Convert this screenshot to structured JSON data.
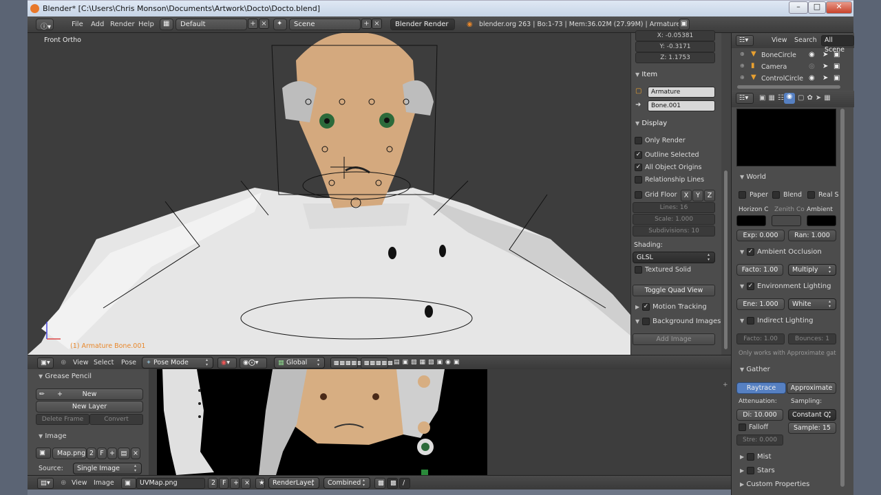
{
  "window": {
    "title": "Blender* [C:\\Users\\Chris Monson\\Documents\\Artwork\\Docto\\Docto.blend]"
  },
  "info_header": {
    "menus": [
      "File",
      "Add",
      "Render",
      "Help"
    ],
    "layout": "Default",
    "scene": "Scene",
    "engine": "Blender Render",
    "stats": "blender.org 263 | Bo:1-73 | Mem:36.02M (27.99M) | Armature"
  },
  "viewport": {
    "view_label": "Front Ortho",
    "object_label": "(1) Armature Bone.001"
  },
  "npanel": {
    "coords": {
      "x": "X: -0.05381",
      "y": "Y: -0.3171",
      "z": "Z: 1.1753"
    },
    "item_header": "Item",
    "object_name": "Armature",
    "bone_name": "Bone.001",
    "display_header": "Display",
    "only_render": "Only Render",
    "outline_selected": "Outline Selected",
    "all_object_origins": "All Object Origins",
    "relationship_lines": "Relationship Lines",
    "grid_floor": "Grid Floor",
    "axis_x": "X",
    "axis_y": "Y",
    "axis_z": "Z",
    "lines": "Lines: 16",
    "scale": "Scale: 1.000",
    "subdivisions": "Subdivisions: 10",
    "shading_label": "Shading:",
    "shading_value": "GLSL",
    "textured_solid": "Textured Solid",
    "toggle_quad": "Toggle Quad View",
    "motion_tracking": "Motion Tracking",
    "background_images": "Background Images",
    "add_image": "Add Image"
  },
  "outliner": {
    "menus": [
      "View",
      "Search",
      "All Scene"
    ],
    "items": [
      "BoneCircle",
      "Camera",
      "ControlCircle"
    ]
  },
  "properties": {
    "world_header": "World",
    "paper": "Paper",
    "blend": "Blend",
    "real": "Real S",
    "horizon": "Horizon C",
    "zenith": "Zenith Co",
    "ambient": "Ambient",
    "exposure": "Exp: 0.000",
    "range": "Ran: 1.000",
    "ao_header": "Ambient Occlusion",
    "ao_factor": "Facto: 1.00",
    "ao_mode": "Multiply",
    "env_header": "Environment Lighting",
    "env_energy": "Ene: 1.000",
    "env_color": "White",
    "indirect_header": "Indirect Lighting",
    "ind_factor": "Facto: 1.00",
    "ind_bounces": "Bounces: 1",
    "ind_note": "Only works with Approximate gat",
    "gather_header": "Gather",
    "raytrace": "Raytrace",
    "approximate": "Approximate",
    "attenuation": "Attenuation:",
    "sampling": "Sampling:",
    "distance": "Di: 10.000",
    "sampling_value": "Constant Q",
    "falloff": "Falloff",
    "samples": "Sample: 15",
    "strength": "Stre: 0.000",
    "mist": "Mist",
    "stars": "Stars",
    "custom": "Custom Properties",
    "colors": {
      "horizon": "#000000",
      "zenith": "#4a4a4a",
      "ambient": "#000000"
    }
  },
  "v3d_header": {
    "menus": [
      "View",
      "Select",
      "Pose"
    ],
    "mode": "Pose Mode",
    "orientation": "Global"
  },
  "image_tools": {
    "grease_header": "Grease Pencil",
    "new": "New",
    "new_layer": "New Layer",
    "delete_frame": "Delete Frame",
    "convert": "Convert",
    "image_header": "Image",
    "image_name": "Map.png",
    "users": "2",
    "fake": "F",
    "source_label": "Source:",
    "source_value": "Single Image"
  },
  "uv_header": {
    "menus": [
      "View",
      "Image"
    ],
    "image_name": "UVMap.png",
    "users": "2",
    "fake": "F",
    "render_layer": "RenderLayer",
    "pass": "Combined"
  },
  "colors": {
    "accent": "#5680c2",
    "orange": "#e8872a",
    "bg": "#3d3d3d"
  }
}
